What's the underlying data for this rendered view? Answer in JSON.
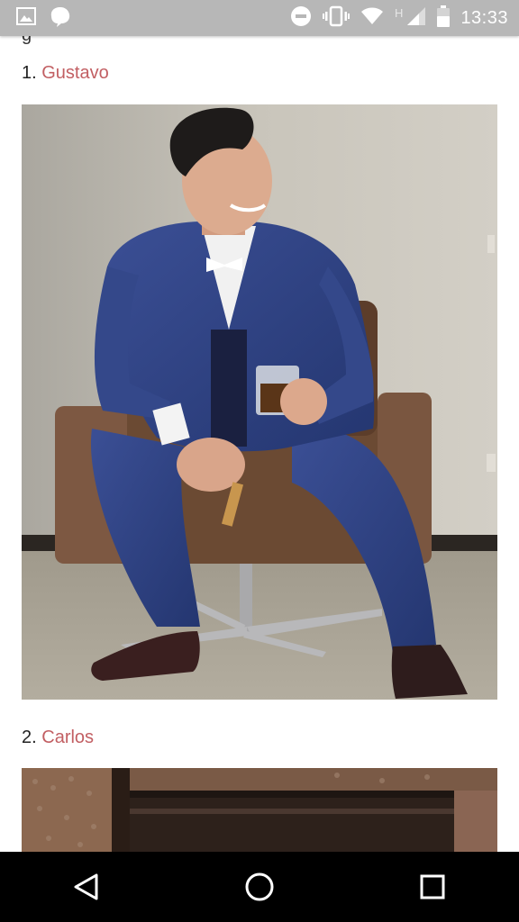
{
  "status_bar": {
    "time": "13:33",
    "network_label": "H",
    "icons": [
      "gallery-icon",
      "notification-app-icon",
      "do-not-disturb-icon",
      "vibrate-icon",
      "wifi-icon",
      "signal-icon",
      "battery-icon"
    ]
  },
  "article": {
    "entries": [
      {
        "number": "1.",
        "name": "Gustavo",
        "image": "man-in-blue-suit-sitting-on-chair-photo"
      },
      {
        "number": "2.",
        "name": "Carlos",
        "image": "brick-building-photo"
      }
    ]
  },
  "nav_bar": {
    "icons": [
      "back-icon",
      "home-icon",
      "recents-icon"
    ]
  },
  "colors": {
    "link": "#c25f63",
    "status_bar": "#b7b7b7",
    "nav_bar": "#000000"
  }
}
